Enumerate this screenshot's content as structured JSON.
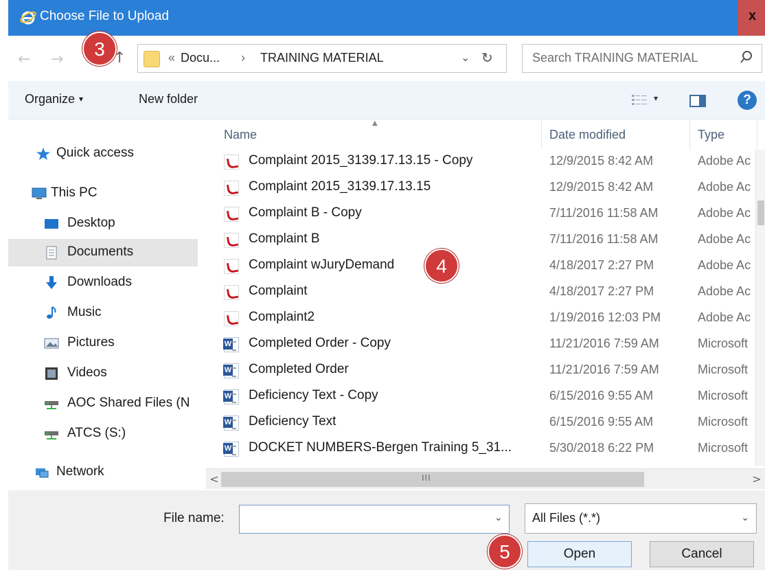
{
  "window": {
    "title": "Choose File to Upload",
    "close_glyph": "x",
    "colors": {
      "titlebar": "#2a7fd6",
      "close": "#c75050"
    }
  },
  "address": {
    "back_glyph": "←",
    "forward_glyph": "→",
    "up_glyph": "↑",
    "prefix": "«",
    "crumb_parent": "Docu...",
    "separator": "›",
    "crumb_current": "TRAINING MATERIAL",
    "dropdown_glyph": "⌄",
    "refresh_glyph": "↻"
  },
  "search": {
    "placeholder": "Search TRAINING MATERIAL",
    "icon": "search-icon"
  },
  "toolbar": {
    "organize_label": "Organize",
    "organize_caret": "▾",
    "new_folder_label": "New folder",
    "view_caret": "▾",
    "help_glyph": "?"
  },
  "nav": {
    "items": [
      {
        "label": "Quick access",
        "icon": "star-icon"
      },
      {
        "label": "This PC",
        "icon": "computer-icon"
      },
      {
        "label": "Desktop",
        "icon": "desktop-icon"
      },
      {
        "label": "Documents",
        "icon": "documents-icon",
        "selected": true
      },
      {
        "label": "Downloads",
        "icon": "download-icon"
      },
      {
        "label": "Music",
        "icon": "music-icon"
      },
      {
        "label": "Pictures",
        "icon": "pictures-icon"
      },
      {
        "label": "Videos",
        "icon": "videos-icon"
      },
      {
        "label": "AOC Shared Files (N",
        "icon": "network-drive-icon"
      },
      {
        "label": "ATCS (S:)",
        "icon": "network-drive-icon"
      },
      {
        "label": "Network",
        "icon": "network-icon"
      }
    ]
  },
  "columns": {
    "name": "Name",
    "date": "Date modified",
    "type": "Type"
  },
  "files": [
    {
      "name": "Complaint 2015_3139.17.13.15 - Copy",
      "date": "12/9/2015 8:42 AM",
      "type": "Adobe Ac",
      "kind": "pdf"
    },
    {
      "name": "Complaint 2015_3139.17.13.15",
      "date": "12/9/2015 8:42 AM",
      "type": "Adobe Ac",
      "kind": "pdf"
    },
    {
      "name": "Complaint B - Copy",
      "date": "7/11/2016 11:58 AM",
      "type": "Adobe Ac",
      "kind": "pdf"
    },
    {
      "name": "Complaint B",
      "date": "7/11/2016 11:58 AM",
      "type": "Adobe Ac",
      "kind": "pdf"
    },
    {
      "name": "Complaint wJuryDemand",
      "date": "4/18/2017 2:27 PM",
      "type": "Adobe Ac",
      "kind": "pdf"
    },
    {
      "name": "Complaint",
      "date": "4/18/2017 2:27 PM",
      "type": "Adobe Ac",
      "kind": "pdf"
    },
    {
      "name": "Complaint2",
      "date": "1/19/2016 12:03 PM",
      "type": "Adobe Ac",
      "kind": "pdf"
    },
    {
      "name": "Completed Order - Copy",
      "date": "11/21/2016 7:59 AM",
      "type": "Microsoft",
      "kind": "doc"
    },
    {
      "name": "Completed Order",
      "date": "11/21/2016 7:59 AM",
      "type": "Microsoft",
      "kind": "doc"
    },
    {
      "name": "Deficiency Text - Copy",
      "date": "6/15/2016 9:55 AM",
      "type": "Microsoft",
      "kind": "doc"
    },
    {
      "name": "Deficiency Text",
      "date": "6/15/2016 9:55 AM",
      "type": "Microsoft",
      "kind": "doc"
    },
    {
      "name": "DOCKET NUMBERS-Bergen Training 5_31...",
      "date": "5/30/2018 6:22 PM",
      "type": "Microsoft",
      "kind": "doc"
    }
  ],
  "scrollbar": {
    "left_glyph": "<",
    "right_glyph": ">",
    "grip": "III"
  },
  "bottom": {
    "file_name_label": "File name:",
    "file_name_value": "",
    "file_name_caret": "⌄",
    "filter_value": "All Files (*.*)",
    "filter_caret": "⌄",
    "open_label": "Open",
    "cancel_label": "Cancel"
  },
  "callouts": {
    "step3": "3",
    "step4": "4",
    "step5": "5",
    "color": "#d03a3a"
  }
}
